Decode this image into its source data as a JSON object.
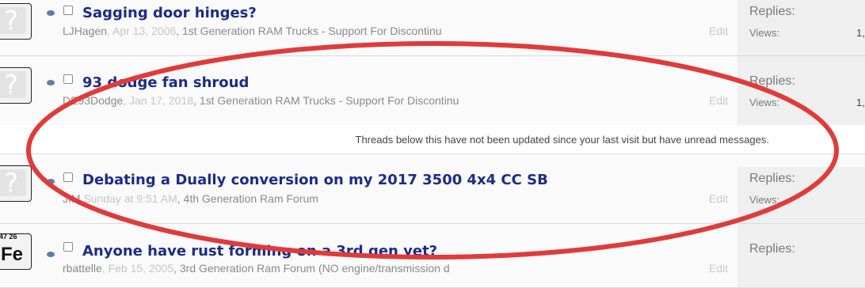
{
  "threads": [
    {
      "title": "Sagging door hinges?",
      "author": "LJHagen",
      "date": "Apr 13, 2006",
      "forum": "1st Generation RAM Trucks - Support For Discontinu",
      "edit": "Edit",
      "replies_label": "Replies:",
      "views_label": "Views:",
      "views_value": "1,"
    },
    {
      "title": "93 dodge fan shroud",
      "author": "DE93Dodge",
      "date": "Jan 17, 2018",
      "forum": "1st Generation RAM Trucks - Support For Discontinu",
      "edit": "Edit",
      "replies_label": "Replies:",
      "views_label": "Views:",
      "views_value": "1,"
    },
    {
      "title": "Debating a Dually conversion on my 2017 3500 4x4 CC SB",
      "author": "JIM",
      "date": "Sunday at 9:51 AM",
      "forum": "4th Generation Ram Forum",
      "edit": "Edit",
      "replies_label": "Replies:",
      "views_label": "Views:"
    },
    {
      "title": "Anyone have rust forming on a 3rd gen yet?",
      "author": "rbattelle",
      "date": "Feb 15, 2005",
      "forum": "3rd Generation Ram Forum (NO engine/transmission d",
      "edit": "Edit",
      "replies_label": "Replies:",
      "avatar_text": "Fe",
      "avatar_numbers": "47 26"
    }
  ],
  "separator_text": "Threads below this have not been updated since your last visit but have unread messages.",
  "colors": {
    "title": "#1c2c86",
    "annotation": "#e03b3b",
    "stats_bg": "#efefef"
  }
}
